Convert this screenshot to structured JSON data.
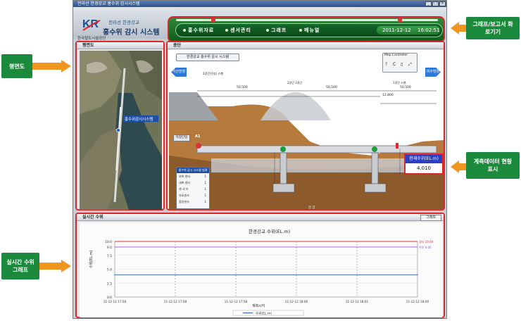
{
  "window": {
    "title": "전라선 한경강교 홍수위 감시시스템"
  },
  "header": {
    "org": "한국철도시설공단",
    "subtitle": "전라선 한경강교",
    "title": "홍수위 감시 시스템",
    "nav": [
      "홍수위자료",
      "센서관리",
      "그래프",
      "메뉴얼"
    ],
    "date": "2011-12-12",
    "time": "16:02:51"
  },
  "plan_panel": {
    "title": "평면도",
    "site_label": "홍수위감시시스템"
  },
  "section_panel": {
    "title": "종단",
    "system_button": "한경강교 홍수위 감시 시스템",
    "left_arrow": "익산방향",
    "right_arrow": "여수방향",
    "map_controller": "Map Controller",
    "map_icons": [
      "?",
      "C",
      "▯",
      "⤢"
    ],
    "dim_labels": [
      "50,500",
      "50,500",
      "50,500",
      "12,800"
    ],
    "span_labels": [
      "2경간(전송) 스팬",
      "2경간 3경간",
      "1경간 스팬"
    ],
    "left_tag": "측정단일",
    "sensor_marker": "A1",
    "legend_title": "홍수위 감시 시스템 범례",
    "legend_rows": [
      "외측 센서",
      "내측 센서",
      "센 서 이",
      "유효센서",
      "중앙센서"
    ],
    "legend_values": [
      "1",
      "1",
      "1",
      "1",
      "1"
    ],
    "water_level_label": "현재수위(EL.m)",
    "water_level_value": "4.010",
    "bottom_label": "현 장"
  },
  "realtime_panel": {
    "title": "실시간 수위",
    "graph_button": "그래프"
  },
  "chart_data": {
    "type": "line",
    "title": "한경강교 수위(EL.m)",
    "xlabel": "계측시각",
    "ylabel": "수위(EL.m)",
    "yticks": [
      "10.0",
      "9.0",
      "7.5",
      "5.0",
      "2.5",
      "0.0"
    ],
    "ylim": [
      0,
      10
    ],
    "xticks": [
      "11-12-12 17:58",
      "11-12-12 17:58",
      "11-12-12 17:58",
      "11-12-12 18:00",
      "11-12-12 18:01",
      "11-12-12 18:00"
    ],
    "threshold_lines": [
      {
        "name": "경보 10.00",
        "value": 10.0,
        "color": "#d8353b"
      },
      {
        "name": "주의 9.00",
        "value": 9.0,
        "color": "#9b59d0"
      }
    ],
    "series": [
      {
        "name": "수위(EL.m)",
        "values": [
          4.01,
          4.01,
          4.01,
          4.01,
          4.01,
          4.01
        ],
        "color": "#2a56c6"
      }
    ],
    "legend": "수위(EL.m)",
    "grid": true
  },
  "callouts": {
    "top_right": "그래프/보고서 화로기기",
    "left_top": "평면도",
    "right_mid": "계측데이터 현황표시",
    "left_bottom": "실시간 수위 그래프"
  },
  "colors": {
    "accent_green": "#1b8a3c",
    "arrow_orange": "#f0951e",
    "highlight_red": "#e0262b"
  }
}
